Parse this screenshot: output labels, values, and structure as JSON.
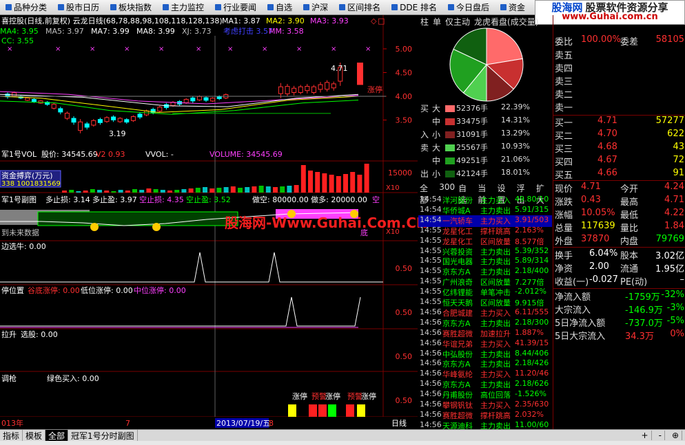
{
  "menu": [
    {
      "label": "品种分类"
    },
    {
      "label": "股市日历"
    },
    {
      "label": "板块指数"
    },
    {
      "label": "主力监控"
    },
    {
      "label": "行业要闻"
    },
    {
      "label": "自选"
    },
    {
      "label": "沪深"
    },
    {
      "label": "区间排名"
    },
    {
      "label": "DDE 排名"
    },
    {
      "label": "今日盘后"
    },
    {
      "label": "资金"
    }
  ],
  "logo": {
    "a": "股海网",
    "b": "股票软件资源分享",
    "url": "www.Guhai.com.cn"
  },
  "watermark": "股海网-Www.Guhai.Com.CN",
  "main_panel": {
    "title": "喜控股(日线,前复权) 云龙日线(68,78,88,98,108,118,128,138)",
    "ma": [
      {
        "label": "MA1:",
        "value": "3.87",
        "color": "#ffffff"
      },
      {
        "label": "MA2:",
        "value": "3.90",
        "color": "#ffff00"
      },
      {
        "label": "MA3:",
        "value": "3.93",
        "color": "#ff40ff"
      }
    ],
    "ma_row2": [
      {
        "label": "MA4:",
        "value": "3.95",
        "color": "#00ff00"
      },
      {
        "label": "MA5:",
        "value": "3.97",
        "color": "#c0c0c0"
      },
      {
        "label": "MA7:",
        "value": "3.99",
        "color": "#ffffff"
      },
      {
        "label": "MA8:",
        "value": "3.99",
        "color": "#ffffff"
      },
      {
        "label": "XJ:",
        "value": "3.73",
        "color": "#c0c0c0"
      },
      {
        "label": "考虑打击",
        "value": "3.57",
        "color": "#4040ff"
      },
      {
        "label": "MM:",
        "value": "3.58",
        "color": "#ff40ff"
      }
    ],
    "cc": "CC: 3.55",
    "high_label": "4.71",
    "low_label": "3.19",
    "zt_label": "涨停",
    "y_ticks": [
      "5.00",
      "4.50",
      "4.00",
      "3.50"
    ]
  },
  "vol_panel": {
    "title": "军1号VOL",
    "items": [
      {
        "label": "股价:",
        "value": "34545.69",
        "color": "#ffffff"
      },
      {
        "label": "V2",
        "value": "0.93",
        "color": "#ff3030"
      },
      {
        "label": "VVOL:",
        "value": "-",
        "color": "#ffffff"
      },
      {
        "label": "VOLUME:",
        "value": "34545.69",
        "color": "#ff40ff"
      }
    ],
    "box": "资金搏弈(万元)",
    "box2": "338 1001831569",
    "y_tick": "15000",
    "x10": "X10"
  },
  "sub1": {
    "title": "军1号副图",
    "items": [
      {
        "label": "多止损:",
        "value": "3.14",
        "color": "#ffffff"
      },
      {
        "label": "多止盈:",
        "value": "3.97",
        "color": "#ffffff"
      },
      {
        "label": "空止损:",
        "value": "4.35",
        "color": "#ff40ff"
      },
      {
        "label": "空止盈:",
        "value": "3.52",
        "color": "#00ff00"
      }
    ],
    "right": "做空: 80000.00  做多: 20000.00",
    "right2": "空",
    "bottom": "到未来数据",
    "di": "底",
    "x10": "X10"
  },
  "sub2": {
    "title": "边选牛",
    "value": ": 0.00",
    "tick": "0.50"
  },
  "sub3": {
    "title": "停位置",
    "items": [
      {
        "label": "谷底涨停:",
        "value": "0.00",
        "color": "#ff3030"
      },
      {
        "label": "低位涨停:",
        "value": "0.00",
        "color": "#ffffff"
      },
      {
        "label": "中位涨停:",
        "value": "0.00",
        "color": "#ff40ff"
      }
    ],
    "tick": "0.50"
  },
  "sub4": {
    "title": "拉升",
    "label": "选股:",
    "value": "0.00",
    "tick": "0.50"
  },
  "sub5": {
    "title": "调枪",
    "label": "绿色买入:",
    "value": "0.00",
    "tick": "0.50",
    "tags": [
      "涨停",
      "预警",
      "涨停",
      "预警",
      "涨停"
    ]
  },
  "x_axis": {
    "left": "013年",
    "mid": "7",
    "date": "2013/07/19/五",
    "right": "8",
    "period": "日线"
  },
  "right_top": {
    "tabs": [
      "柱",
      "单",
      "仅主动",
      "龙虎看盘(成交量)"
    ],
    "flows": [
      {
        "side": "买",
        "size": "大",
        "color": "#ff6a6a",
        "vol": "52376手",
        "pct": "22.39%"
      },
      {
        "side": "",
        "size": "中",
        "color": "#c83030",
        "vol": "33475手",
        "pct": "14.31%"
      },
      {
        "side": "入",
        "size": "小",
        "color": "#802020",
        "vol": "31091手",
        "pct": "13.29%"
      },
      {
        "side": "卖",
        "size": "大",
        "color": "#50d050",
        "vol": "25567手",
        "pct": "10.93%"
      },
      {
        "side": "",
        "size": "中",
        "color": "#20a020",
        "vol": "49251手",
        "pct": "21.06%"
      },
      {
        "side": "出",
        "size": "小",
        "color": "#106010",
        "vol": "42124手",
        "pct": "18.01%"
      }
    ],
    "bottom_tabs": [
      "全部",
      "300",
      "自选",
      "当前",
      "设置",
      "浮出",
      "扩大"
    ]
  },
  "ticks": [
    {
      "t": "14:54",
      "n": "洋河股份",
      "e": "主力买入",
      "v": "49.80/10",
      "c": "#00ff00"
    },
    {
      "t": "14:54",
      "n": "华侨城A",
      "e": "主力卖出",
      "v": "5.91/315",
      "c": "#00ff00"
    },
    {
      "t": "14:54",
      "n": "一汽轿车",
      "e": "主力买入",
      "v": "3.91/503",
      "c": "#ff3030",
      "sel": true
    },
    {
      "t": "14:55",
      "n": "龙星化工",
      "e": "撑杆跳高",
      "v": "2.163%",
      "c": "#ff3030"
    },
    {
      "t": "14:55",
      "n": "龙星化工",
      "e": "区间放量",
      "v": "8.577倍",
      "c": "#ff3030"
    },
    {
      "t": "14:55",
      "n": "兴蓉投资",
      "e": "主力卖出",
      "v": "5.39/352",
      "c": "#00ff00"
    },
    {
      "t": "14:55",
      "n": "国光电器",
      "e": "主力卖出",
      "v": "5.89/314",
      "c": "#00ff00"
    },
    {
      "t": "14:55",
      "n": "京东方A",
      "e": "主力卖出",
      "v": "2.18/400",
      "c": "#00ff00"
    },
    {
      "t": "14:55",
      "n": "广州浪奇",
      "e": "区间放量",
      "v": "7.277倍",
      "c": "#00ff00"
    },
    {
      "t": "14:55",
      "n": "亿纬锂能",
      "e": "单笔冲击",
      "v": "-2.012%",
      "c": "#00ff00"
    },
    {
      "t": "14:55",
      "n": "恒天天鹅",
      "e": "区间放量",
      "v": "9.915倍",
      "c": "#00ff00"
    },
    {
      "t": "14:56",
      "n": "合肥城建",
      "e": "主力买入",
      "v": "6.11/555",
      "c": "#ff3030"
    },
    {
      "t": "14:56",
      "n": "京东方A",
      "e": "主力卖出",
      "v": "2.18/300",
      "c": "#00ff00"
    },
    {
      "t": "14:56",
      "n": "赛胜超微",
      "e": "加速拉升",
      "v": "1.887%",
      "c": "#ff3030"
    },
    {
      "t": "14:56",
      "n": "华谊兄弟",
      "e": "主力买入",
      "v": "41.39/15",
      "c": "#ff3030"
    },
    {
      "t": "14:56",
      "n": "中弘股份",
      "e": "主力卖出",
      "v": "8.44/406",
      "c": "#00ff00"
    },
    {
      "t": "14:56",
      "n": "京东方A",
      "e": "主力卖出",
      "v": "2.18/426",
      "c": "#00ff00"
    },
    {
      "t": "14:56",
      "n": "华峰氨纶",
      "e": "主力买入",
      "v": "11.20/46",
      "c": "#ff3030"
    },
    {
      "t": "14:56",
      "n": "京东方A",
      "e": "主力卖出",
      "v": "2.18/626",
      "c": "#00ff00"
    },
    {
      "t": "14:56",
      "n": "丹甫股份",
      "e": "高位回落",
      "v": "-1.526%",
      "c": "#00ff00"
    },
    {
      "t": "14:56",
      "n": "攀钢钒钛",
      "e": "主力买入",
      "v": "2.35/630",
      "c": "#ff3030"
    },
    {
      "t": "14:56",
      "n": "赛胜超微",
      "e": "撑杆跳高",
      "v": "2.032%",
      "c": "#ff3030"
    },
    {
      "t": "14:56",
      "n": "天源迪科",
      "e": "主力卖出",
      "v": "11.00/60",
      "c": "#00ff00"
    }
  ],
  "quote": {
    "ratio": {
      "l": "委比",
      "v": "100.00%",
      "l2": "委差",
      "v2": "58105"
    },
    "sells": [
      {
        "label": "卖五"
      },
      {
        "label": "卖四"
      },
      {
        "label": "卖三"
      },
      {
        "label": "卖二"
      },
      {
        "label": "卖一"
      }
    ],
    "buys": [
      {
        "label": "买一",
        "p": "4.71",
        "v": "57277"
      },
      {
        "label": "买二",
        "p": "4.70",
        "v": "622"
      },
      {
        "label": "买三",
        "p": "4.68",
        "v": "43"
      },
      {
        "label": "买四",
        "p": "4.67",
        "v": "72"
      },
      {
        "label": "买五",
        "p": "4.66",
        "v": "91"
      }
    ],
    "stats": [
      {
        "l": "现价",
        "v": "4.71",
        "c": "#ff3030",
        "l2": "今开",
        "v2": "4.24",
        "c2": "#ff3030"
      },
      {
        "l": "涨跌",
        "v": "0.43",
        "c": "#ff3030",
        "l2": "最高",
        "v2": "4.71",
        "c2": "#ff3030"
      },
      {
        "l": "涨幅",
        "v": "10.05%",
        "c": "#ff3030",
        "l2": "最低",
        "v2": "4.22",
        "c2": "#ff3030"
      },
      {
        "l": "总量",
        "v": "117639",
        "c": "#ffff00",
        "l2": "量比",
        "v2": "1.84",
        "c2": "#ff3030"
      },
      {
        "l": "外盘",
        "v": "37870",
        "c": "#ff3030",
        "l2": "内盘",
        "v2": "79769",
        "c2": "#00ff00"
      }
    ],
    "stats2": [
      {
        "l": "换手",
        "v": "6.04%",
        "c": "#ffffff",
        "l2": "股本",
        "v2": "3.02亿",
        "c2": "#ffffff"
      },
      {
        "l": "净资",
        "v": "2.00",
        "c": "#ffffff",
        "l2": "流通",
        "v2": "1.95亿",
        "c2": "#ffffff"
      },
      {
        "l": "收益(一)",
        "v": "-0.027",
        "c": "#ffffff",
        "l2": "PE(动)",
        "v2": "–",
        "c2": "#ffffff"
      }
    ],
    "flow": [
      {
        "l": "净流入额",
        "v": "-1759万",
        "p": "-32%"
      },
      {
        "l": "大宗流入",
        "v": "-146.9万",
        "p": "-3%"
      },
      {
        "l": "5日净流入额",
        "v": "-737.0万",
        "p": "-5%"
      },
      {
        "l": "5日大宗流入",
        "v": "34.3万",
        "p": "0%"
      }
    ]
  },
  "bottom_bar": {
    "tabs": [
      "指标",
      "模板",
      "全部",
      "冠军1号分时副图"
    ],
    "zoom": [
      "+",
      "-",
      "⊕"
    ]
  },
  "colors": {
    "up": "#ff3030",
    "down": "#00ff00",
    "border": "#7a0000"
  }
}
